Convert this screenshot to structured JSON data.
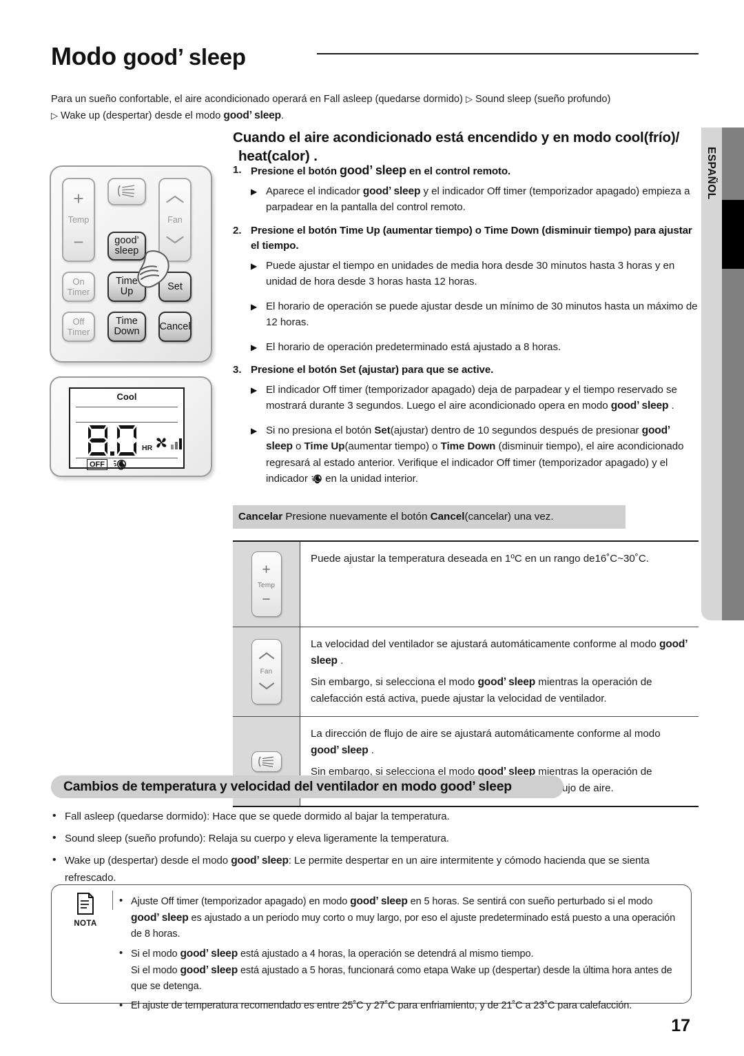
{
  "header": {
    "title_prefix": "Modo ",
    "title_brand": "good’ sleep",
    "language_tab": "ESPAÑOL",
    "page_number": "17"
  },
  "intro": {
    "line1_a": "Para un sueño confortable, el aire acondicionado operará en Fall asleep (quedarse dormido) ",
    "tri": "▷",
    "line1_b": " Sound sleep (sueño profundo)",
    "line2_a": " Wake up (despertar) desde el modo ",
    "line2_brand": "good’ sleep",
    "line2_b": "."
  },
  "section1": {
    "heading_line1": "Cuando el aire acondicionado está encendido y en modo cool(frío)/",
    "heading_line2": "heat(calor) .",
    "steps": [
      {
        "num": "1.",
        "text_a": "Presione el botón ",
        "brand": "good’ sleep",
        "text_b": " en el control remoto.",
        "bullets": [
          {
            "a": "Aparece el indicador ",
            "brand": "good’ sleep",
            "b": " y el indicador Off timer (temporizador apagado) empieza a parpadear en la pantalla del control remoto."
          }
        ]
      },
      {
        "num": "2.",
        "text_a": "Presione el botón Time Up (aumentar tiempo) o Time Down (disminuir tiempo) para ajustar el tiempo.",
        "brand": "",
        "text_b": "",
        "bullets": [
          {
            "a": "Puede ajustar el tiempo en unidades de media hora desde 30 minutos hasta 3 horas y en unidad de hora desde 3 horas hasta 12 horas.",
            "brand": "",
            "b": ""
          },
          {
            "a": "El horario de operación se puede ajustar desde un mínimo de 30 minutos hasta un máximo de 12 horas.",
            "brand": "",
            "b": ""
          },
          {
            "a": "El horario de operación predeterminado está ajustado a 8 horas.",
            "brand": "",
            "b": ""
          }
        ]
      },
      {
        "num": "3.",
        "text_a": "Presione el botón Set (ajustar) para que se active.",
        "brand": "",
        "text_b": "",
        "bullets": [
          {
            "a": "El indicador Off timer (temporizador apagado) deja de parpadear y el tiempo reservado se mostrará durante 3 segundos. Luego el aire acondicionado opera en modo ",
            "brand": "good’ sleep",
            "b": " ."
          }
        ]
      }
    ],
    "bullet_set_long": {
      "p1": "Si no presiona el botón ",
      "set_bold": "Set",
      "p2": "(ajustar) dentro de 10 segundos después de presionar ",
      "brand1": "good’ sleep",
      "p3": " o ",
      "timeup_bold": "Time Up",
      "p4": "(aumentar tiempo) o ",
      "timedown_bold": "Time Down",
      "p5": " (disminuir tiempo), el aire acondicionado regresará al estado anterior. Verifique el indicador Off timer (temporizador apagado) y el indicador ",
      "p6": " en la unidad interior."
    },
    "cancel_bar": {
      "label_bold": "Cancelar",
      "text_a": "  Presione nuevamente el botón  ",
      "cancel_bold": "Cancel",
      "text_b": "(cancelar) una vez."
    }
  },
  "remote": {
    "keys": {
      "temp_plus": "+",
      "temp_label": "Temp",
      "temp_minus": "−",
      "airflow": "airflow-swing-icon",
      "fan_label": "Fan",
      "good_sleep_l1": "good’",
      "good_sleep_l2": "sleep",
      "on_timer_l1": "On",
      "on_timer_l2": "Timer",
      "time_up_l1": "Time",
      "time_up_l2": "Up",
      "set": "Set",
      "off_timer_l1": "Off",
      "off_timer_l2": "Timer",
      "time_down_l1": "Time",
      "time_down_l2": "Down",
      "cancel": "Cancel"
    }
  },
  "lcd": {
    "mode": "Cool",
    "time_value": "8.0",
    "unit": "HR",
    "off_badge": "OFF",
    "fan_icon": "fan-icon",
    "sleep_icon": "good-sleep-icon",
    "signal_icon": "signal-bars-icon"
  },
  "table": {
    "rows": [
      {
        "icon": "temp-key-icon",
        "icon_labels": {
          "plus": "+",
          "cap": "Temp",
          "minus": "−"
        },
        "paragraphs": [
          {
            "a": "Puede ajustar la temperatura deseada en 1ºC en un rango de16˚C~30˚C.",
            "brand": "",
            "b": ""
          }
        ]
      },
      {
        "icon": "fan-key-icon",
        "icon_labels": {
          "cap": "Fan"
        },
        "paragraphs": [
          {
            "a": "La velocidad del ventilador se ajustará automáticamente conforme al modo ",
            "brand": "good’ sleep",
            "b": " ."
          },
          {
            "a": "Sin embargo, si selecciona el modo ",
            "brand": "good’ sleep",
            "b": " mientras la operación de calefacción está activa, puede ajustar la velocidad de ventilador."
          }
        ]
      },
      {
        "icon": "airflow-key-icon",
        "icon_labels": {},
        "paragraphs": [
          {
            "a": "La dirección de flujo de aire se ajustará automáticamente conforme al modo ",
            "brand": "good’ sleep",
            "b": " ."
          },
          {
            "a": "Sin embargo, si selecciona el modo ",
            "brand": "good’ sleep",
            "b": " mientras la operación de calefacción está activa, puede ajustar la dirección de flujo de aire."
          }
        ]
      }
    ]
  },
  "section2": {
    "heading_a": "Cambios de temperatura y velocidad del ventilador en modo ",
    "heading_brand": "good’ sleep",
    "bullets": [
      {
        "a": "Fall asleep (quedarse dormido): Hace que se quede dormido al bajar la temperatura.",
        "brand": "",
        "b": ""
      },
      {
        "a": "Sound sleep (sueño profundo): Relaja su cuerpo y eleva ligeramente la temperatura.",
        "brand": "",
        "b": ""
      },
      {
        "a": "Wake up (despertar) desde el modo ",
        "brand": "good’ sleep",
        "b": ": Le permite despertar en un aire intermitente y cómodo hacienda que se sienta refrescado."
      }
    ]
  },
  "note": {
    "label": "NOTA",
    "icon": "note-document-icon",
    "items": [
      {
        "a": "Ajuste Off timer (temporizador apagado) en modo ",
        "brand1": "good’ sleep",
        "b": " en 5 horas. Se sentirá con sueño perturbado si el modo ",
        "brand2": "good’ sleep",
        "c": " es ajustado a un periodo muy corto o muy largo, por eso el ajuste predeterminado está puesto a una operación de 8 horas."
      },
      {
        "a": "Si el modo ",
        "brand1": "good’ sleep",
        "b": " está ajustado a 4 horas, la operación se detendrá al mismo tiempo.",
        "line2_a": "Si el modo ",
        "brand2": "good’ sleep",
        "line2_b": " está ajustado a 5 horas, funcionará como etapa Wake up (despertar) desde la última hora antes de que se detenga."
      },
      {
        "a": "El ajuste de temperatura recomendado es entre 25˚C y 27˚C para enfriamiento, y de 21˚C a 23˚C para calefacción.",
        "brand1": "",
        "b": ""
      }
    ]
  },
  "colors": {
    "accent_gray": "#cfcfcf",
    "tab_gray": "#d6d6d6",
    "strip_gray": "#808080",
    "rule_black": "#1a1a1a"
  }
}
